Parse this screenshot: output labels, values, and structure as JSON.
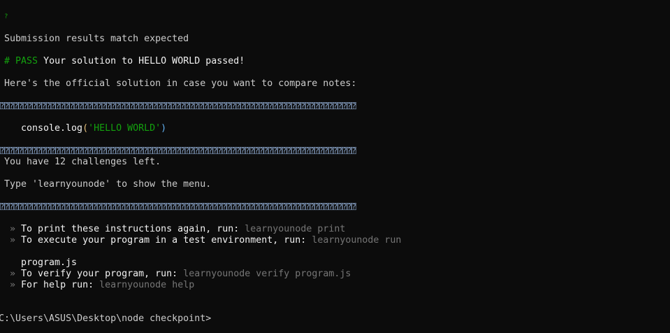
{
  "status_icon": "?",
  "lines": {
    "match": "Submission results match expected",
    "pass_tag": "# PASS",
    "pass_msg": "Your solution to HELLO WORLD passed!",
    "official": "Here's the official solution in case you want to compare notes:",
    "code_prefix": "console.log",
    "code_open": "(",
    "code_string": "'HELLO WORLD'",
    "code_close": ")",
    "remaining": "You have 12 challenges left.",
    "type_menu": "Type 'learnyounode' to show the menu."
  },
  "separator": "⍰⍰⍰⍰⍰⍰⍰⍰⍰⍰⍰⍰⍰⍰⍰⍰⍰⍰⍰⍰⍰⍰⍰⍰⍰⍰⍰⍰⍰⍰⍰⍰⍰⍰⍰⍰⍰⍰⍰⍰⍰⍰⍰⍰⍰⍰⍰⍰⍰⍰⍰⍰⍰⍰⍰⍰⍰⍰⍰⍰⍰⍰⍰⍰⍰⍰⍰⍰⍰⍰⍰⍰⍰⍰⍰⍰⍰",
  "instructions": {
    "bullet": "»",
    "print_text": "To print these instructions again, run:",
    "print_cmd": "learnyounode print",
    "run_text": "To execute your program in a test environment, run:",
    "run_cmd": "learnyounode run",
    "run_arg": "program.js",
    "verify_text": "To verify your program, run:",
    "verify_cmd": "learnyounode verify program.js",
    "help_text": "For help run:",
    "help_cmd": "learnyounode help"
  },
  "prompt": "C:\\Users\\ASUS\\Desktop\\node checkpoint>"
}
